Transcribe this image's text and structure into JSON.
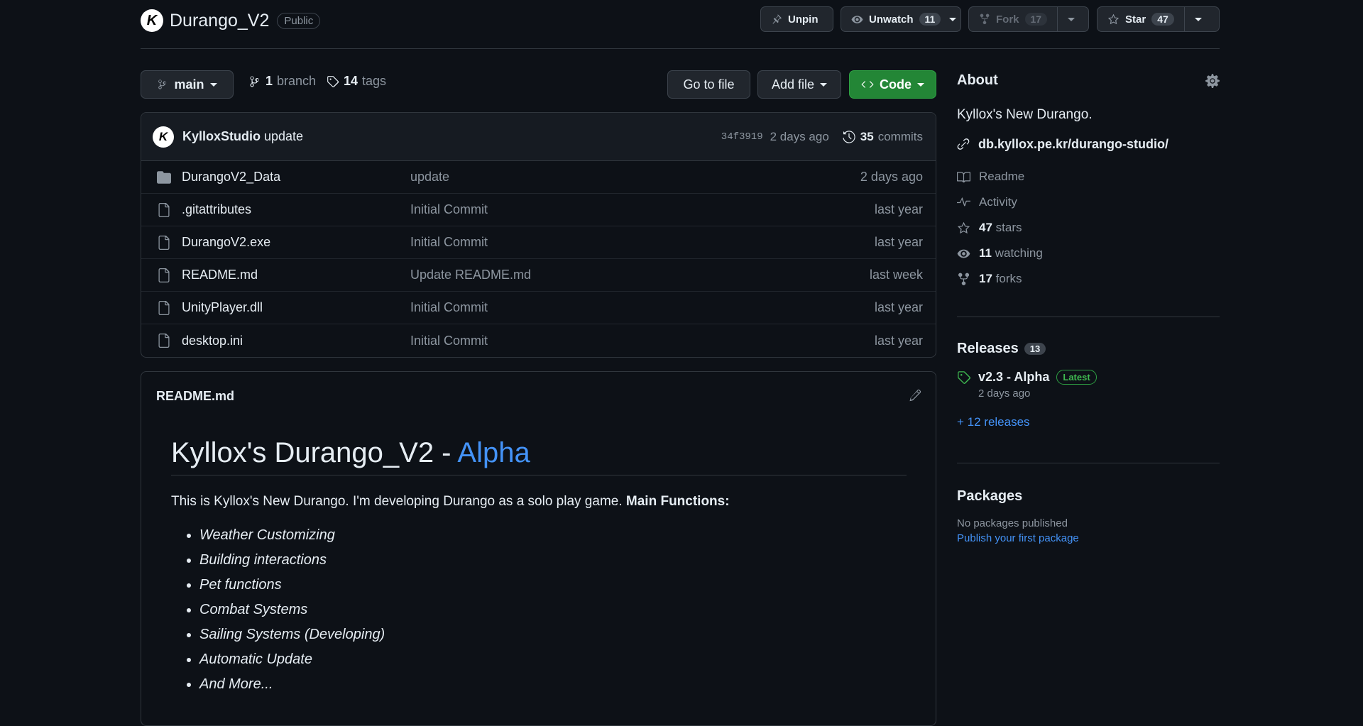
{
  "repo": {
    "name": "Durango_V2",
    "visibility": "Public",
    "avatar_letter": "K"
  },
  "header_actions": {
    "unpin_label": "Unpin",
    "watch_label": "Unwatch",
    "watch_count": "11",
    "fork_label": "Fork",
    "fork_count": "17",
    "star_label": "Star",
    "star_count": "47"
  },
  "toolbar": {
    "branch_name": "main",
    "branch_count": "1",
    "branch_label": "branch",
    "tag_count": "14",
    "tag_label": "tags",
    "go_to_file": "Go to file",
    "add_file": "Add file",
    "code": "Code"
  },
  "latest_commit": {
    "author": "KylloxStudio",
    "message": "update",
    "sha": "34f3919",
    "date": "2 days ago",
    "commit_count": "35",
    "commit_label": "commits"
  },
  "files": [
    {
      "name": "DurangoV2_Data",
      "type": "folder",
      "message": "update",
      "date": "2 days ago"
    },
    {
      "name": ".gitattributes",
      "type": "file",
      "message": "Initial Commit",
      "date": "last year"
    },
    {
      "name": "DurangoV2.exe",
      "type": "file",
      "message": "Initial Commit",
      "date": "last year"
    },
    {
      "name": "README.md",
      "type": "file",
      "message": "Update README.md",
      "date": "last week"
    },
    {
      "name": "UnityPlayer.dll",
      "type": "file",
      "message": "Initial Commit",
      "date": "last year"
    },
    {
      "name": "desktop.ini",
      "type": "file",
      "message": "Initial Commit",
      "date": "last year"
    }
  ],
  "readme": {
    "file_label": "README.md",
    "heading_main": "Kyllox's Durango_V2 - ",
    "heading_accent": "Alpha",
    "intro": "This is Kyllox's New Durango. I'm developing Durango as a solo play game. ",
    "intro_bold": "Main Functions:",
    "features": [
      "Weather Customizing",
      "Building interactions",
      "Pet functions",
      "Combat Systems",
      "Sailing Systems (Developing)",
      "Automatic Update",
      "And More..."
    ]
  },
  "about": {
    "title": "About",
    "description": "Kyllox's New Durango.",
    "website": "db.kyllox.pe.kr/durango-studio/",
    "readme": "Readme",
    "activity": "Activity",
    "stars_count": "47",
    "stars_label": "stars",
    "watching_count": "11",
    "watching_label": "watching",
    "forks_count": "17",
    "forks_label": "forks"
  },
  "releases": {
    "title": "Releases",
    "count": "13",
    "latest_name": "v2.3 - Alpha",
    "latest_badge": "Latest",
    "latest_date": "2 days ago",
    "more_link": "+ 12 releases"
  },
  "packages": {
    "title": "Packages",
    "empty_text": "No packages published",
    "publish_link": "Publish your first package"
  },
  "colors": {
    "background": "#0d1117",
    "accent_blue": "#4493f8",
    "code_button": "#238636",
    "latest_badge": "#3fb950"
  }
}
